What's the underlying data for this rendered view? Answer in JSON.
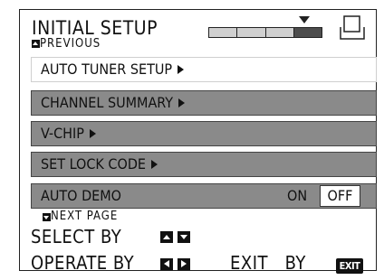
{
  "header": {
    "title": "INITIAL SETUP",
    "previous_label": "PREVIOUS",
    "tv_icon": "tv-screen-icon",
    "progress_active_step": 4,
    "progress_total_steps": 4
  },
  "menu": {
    "items": [
      {
        "label": "AUTO TUNER SETUP",
        "has_submenu": true,
        "selected": true
      },
      {
        "label": "CHANNEL SUMMARY",
        "has_submenu": true,
        "selected": false
      },
      {
        "label": "V-CHIP",
        "has_submenu": true,
        "selected": false
      },
      {
        "label": "SET LOCK CODE",
        "has_submenu": true,
        "selected": false
      },
      {
        "label": "AUTO DEMO",
        "has_submenu": false,
        "selected": false,
        "options": [
          "ON",
          "OFF"
        ],
        "current": "OFF"
      }
    ]
  },
  "footer": {
    "next_page_label": "NEXT  PAGE",
    "select_label": "SELECT  BY",
    "operate_label": "OPERATE BY",
    "exit_label": "EXIT   BY",
    "exit_key_label": "EXIT"
  },
  "colors": {
    "menu_bg": "#8a8a8a",
    "selected_bg": "#ffffff",
    "progress_active": "#4d4d4d",
    "progress_inactive": "#d0d0d0"
  }
}
